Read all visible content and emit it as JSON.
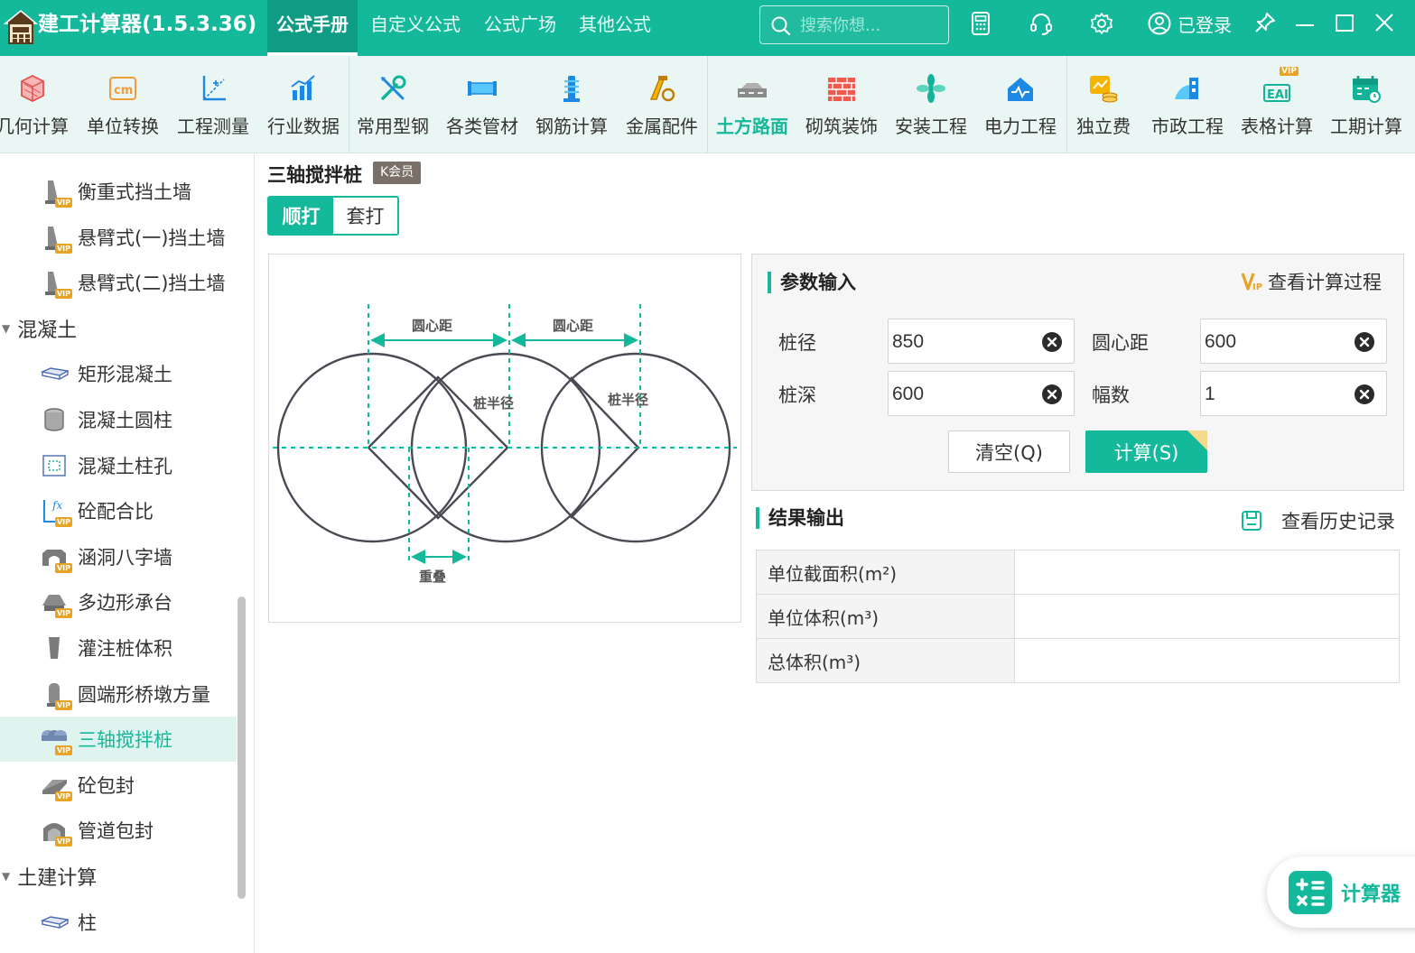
{
  "app": {
    "title": "建工计算器(1.5.3.36)"
  },
  "main_tabs": [
    {
      "label": "公式手册",
      "active": true
    },
    {
      "label": "自定义公式",
      "active": false
    },
    {
      "label": "公式广场",
      "active": false
    },
    {
      "label": "其他公式",
      "active": false
    }
  ],
  "search": {
    "placeholder": "搜索你想..."
  },
  "account": {
    "status": "已登录"
  },
  "toolbar": [
    {
      "label": "几何计算",
      "icon": "cube-icon"
    },
    {
      "label": "单位转换",
      "icon": "unit-convert-icon"
    },
    {
      "label": "工程测量",
      "icon": "survey-icon"
    },
    {
      "label": "行业数据",
      "icon": "bar-chart-icon"
    },
    {
      "label": "常用型钢",
      "icon": "wrench-icon"
    },
    {
      "label": "各类管材",
      "icon": "pipe-icon"
    },
    {
      "label": "钢筋计算",
      "icon": "rebar-icon"
    },
    {
      "label": "金属配件",
      "icon": "metal-fitting-icon"
    },
    {
      "label": "土方路面",
      "icon": "road-icon",
      "active": true
    },
    {
      "label": "砌筑装饰",
      "icon": "brick-icon"
    },
    {
      "label": "安装工程",
      "icon": "fan-icon"
    },
    {
      "label": "电力工程",
      "icon": "power-icon"
    },
    {
      "label": "独立费",
      "icon": "coins-icon"
    },
    {
      "label": "市政工程",
      "icon": "municipal-icon"
    },
    {
      "label": "表格计算",
      "icon": "table-ai-icon",
      "vip": "VIP"
    },
    {
      "label": "工期计算",
      "icon": "calendar-icon"
    }
  ],
  "sidebar": {
    "items": [
      {
        "label": "衡重式挡土墙",
        "type": "item",
        "icon": "retaining-wall-icon",
        "vip": true
      },
      {
        "label": "悬臂式(一)挡土墙",
        "type": "item",
        "icon": "retaining-wall-icon",
        "vip": true
      },
      {
        "label": "悬臂式(二)挡土墙",
        "type": "item",
        "icon": "retaining-wall-icon",
        "vip": true
      },
      {
        "label": "混凝土",
        "type": "group"
      },
      {
        "label": "矩形混凝土",
        "type": "item",
        "icon": "slab-icon",
        "vip": false
      },
      {
        "label": "混凝土圆柱",
        "type": "item",
        "icon": "cylinder-icon",
        "vip": false
      },
      {
        "label": "混凝土柱孔",
        "type": "item",
        "icon": "column-hole-icon",
        "vip": false
      },
      {
        "label": "砼配合比",
        "type": "item",
        "icon": "mix-ratio-icon",
        "vip": true
      },
      {
        "label": "涵洞八字墙",
        "type": "item",
        "icon": "culvert-icon",
        "vip": true
      },
      {
        "label": "多边形承台",
        "type": "item",
        "icon": "pile-cap-icon",
        "vip": true
      },
      {
        "label": "灌注桩体积",
        "type": "item",
        "icon": "pile-icon",
        "vip": false
      },
      {
        "label": "圆端形桥墩方量",
        "type": "item",
        "icon": "pier-icon",
        "vip": true
      },
      {
        "label": "三轴搅拌桩",
        "type": "item",
        "icon": "triple-pile-icon",
        "vip": true,
        "selected": true
      },
      {
        "label": "砼包封",
        "type": "item",
        "icon": "encasement-icon",
        "vip": true
      },
      {
        "label": "管道包封",
        "type": "item",
        "icon": "pipe-encasement-icon",
        "vip": true
      },
      {
        "label": "土建计算",
        "type": "group"
      },
      {
        "label": "柱",
        "type": "item",
        "icon": "slab-icon",
        "vip": false
      }
    ],
    "vip_mark": "VIP"
  },
  "content": {
    "title": "三轴搅拌桩",
    "member_badge": "K会员",
    "modes": [
      {
        "label": "顺打",
        "active": true
      },
      {
        "label": "套打",
        "active": false
      }
    ]
  },
  "diagram": {
    "labels": {
      "center_distance_1": "圆心距",
      "center_distance_2": "圆心距",
      "pile_radius_1": "桩半径",
      "pile_radius_2": "桩半径",
      "overlap": "重叠"
    }
  },
  "params": {
    "section_title": "参数输入",
    "view_process": "查看计算过程",
    "fields": [
      {
        "label": "桩径",
        "value": "850"
      },
      {
        "label": "圆心距",
        "value": "600"
      },
      {
        "label": "桩深",
        "value": "600"
      },
      {
        "label": "幅数",
        "value": "1"
      }
    ],
    "clear_label": "清空(Q)",
    "calc_label": "计算(S)"
  },
  "results": {
    "section_title": "结果输出",
    "view_history": "查看历史记录",
    "rows": [
      {
        "label": "单位截面积(m²)",
        "value": ""
      },
      {
        "label": "单位体积(m³)",
        "value": ""
      },
      {
        "label": "总体积(m³)",
        "value": ""
      }
    ]
  },
  "fab": {
    "label": "计算器"
  },
  "colors": {
    "primary": "#14b89b",
    "primary_dark": "#0f9c84",
    "toolbar_bg": "#e9f6f3",
    "vip_badge": "#7a7067",
    "vip_gold": "#e8a325"
  }
}
